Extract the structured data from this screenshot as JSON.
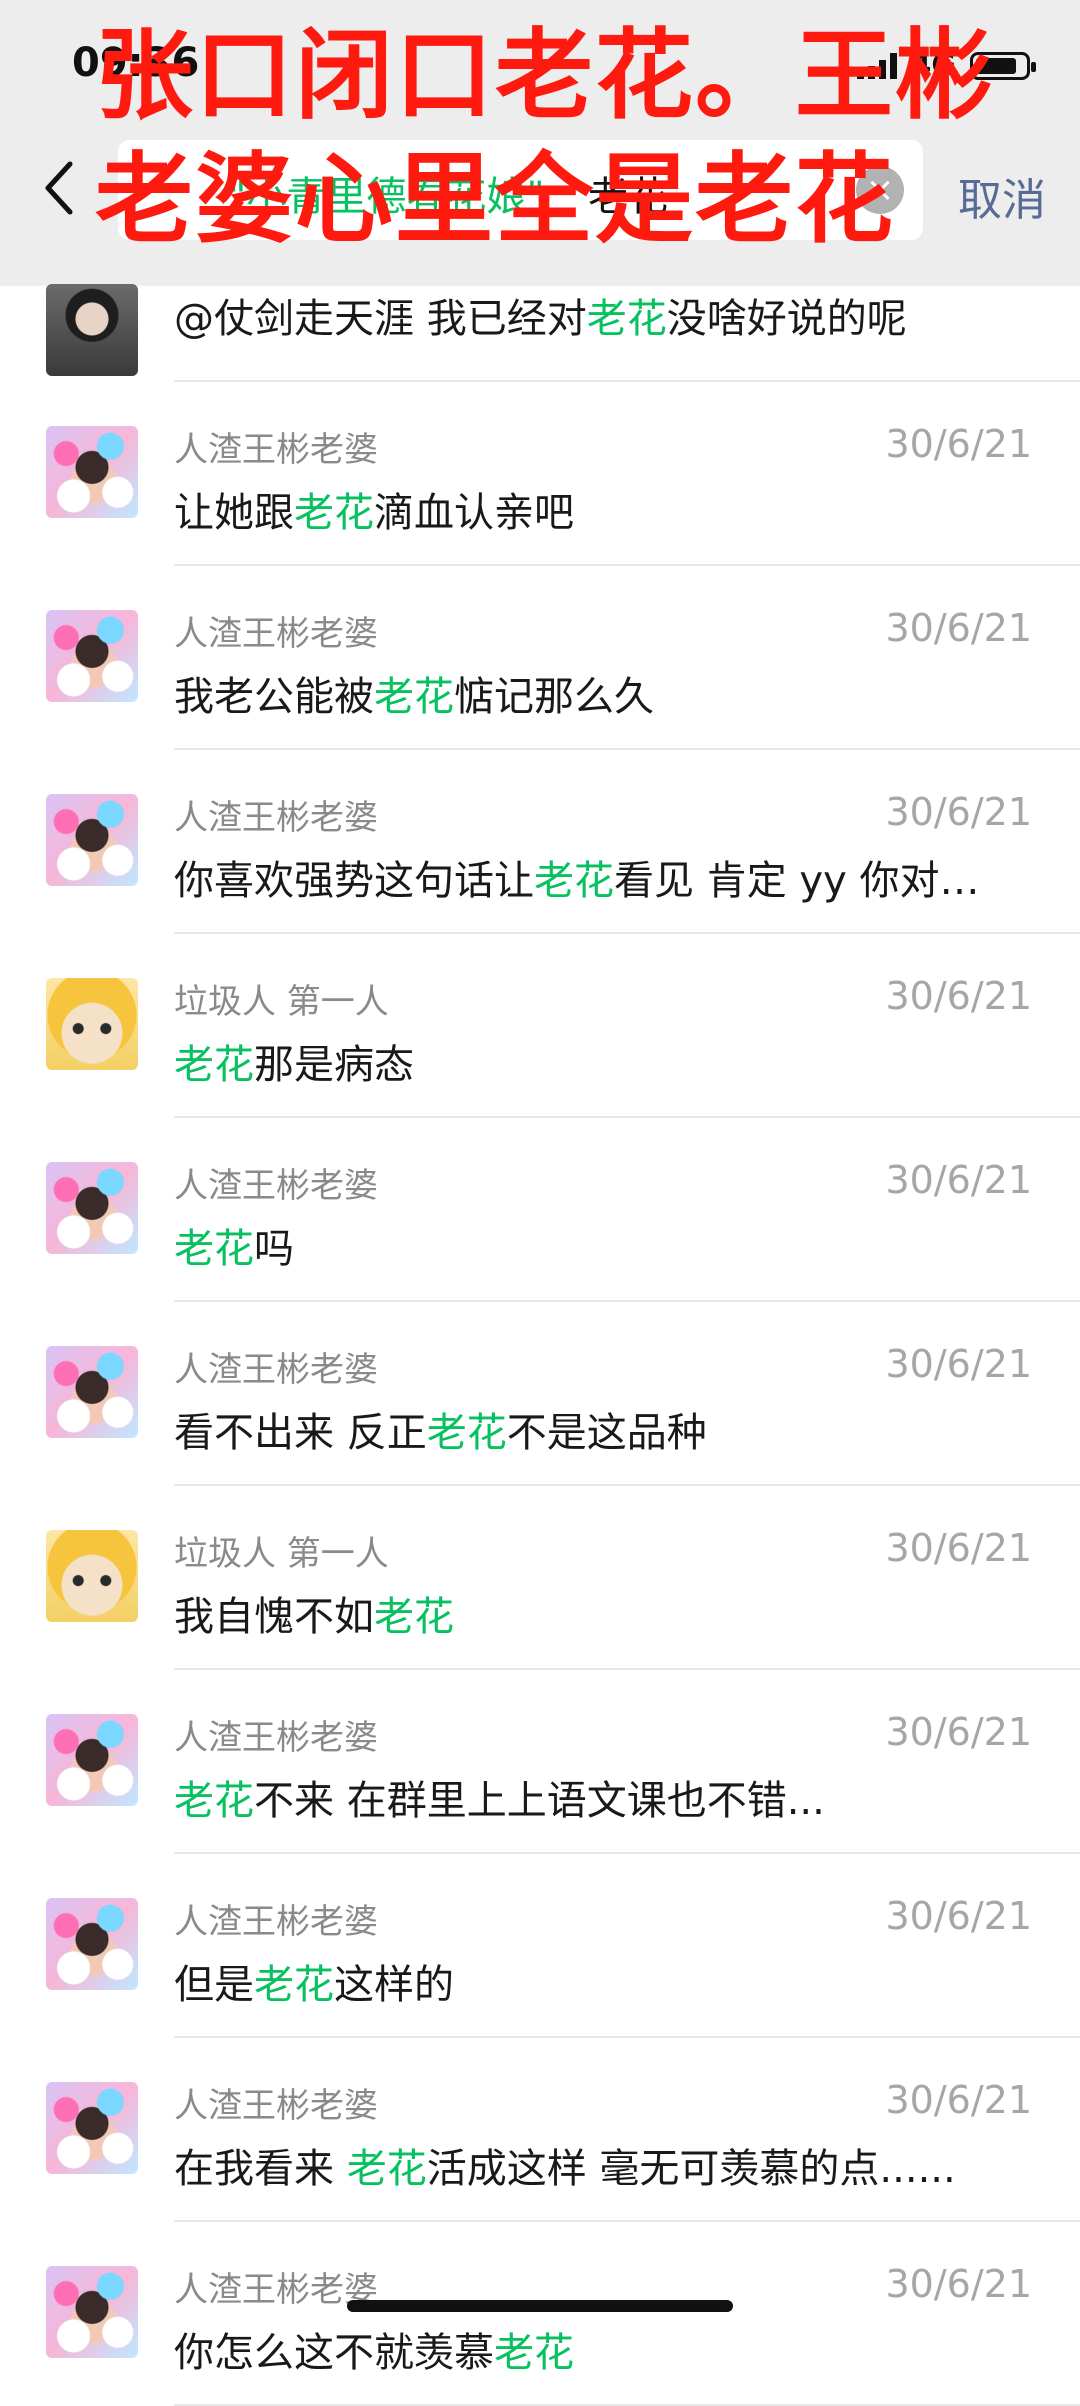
{
  "status_bar": {
    "time": "09:36",
    "network": "4G"
  },
  "search": {
    "chip": "\"小青里德春花娘\"",
    "query": "老花",
    "cancel_label": "取消"
  },
  "overlay": {
    "caption": "张口闭口老花。王彬老婆心里全是老花"
  },
  "results": [
    {
      "avatar": "photo",
      "sender": "",
      "date": "",
      "pre": "@仗剑走天涯 我已经对",
      "hl": "老花",
      "post": "没啥好说的呢",
      "partial": true
    },
    {
      "avatar": "balls",
      "sender": "人渣王彬老婆",
      "date": "30/6/21",
      "pre": "让她跟",
      "hl": "老花",
      "post": "滴血认亲吧"
    },
    {
      "avatar": "balls",
      "sender": "人渣王彬老婆",
      "date": "30/6/21",
      "pre": "我老公能被",
      "hl": "老花",
      "post": "惦记那么久"
    },
    {
      "avatar": "balls",
      "sender": "人渣王彬老婆",
      "date": "30/6/21",
      "pre": "你喜欢强势这句话让",
      "hl": "老花",
      "post": "看见 肯定 yy 你对…"
    },
    {
      "avatar": "cat",
      "sender": "垃圾人 第一人",
      "date": "30/6/21",
      "pre": "",
      "hl": "老花",
      "post": "那是病态"
    },
    {
      "avatar": "balls",
      "sender": "人渣王彬老婆",
      "date": "30/6/21",
      "pre": "",
      "hl": "老花",
      "post": "吗"
    },
    {
      "avatar": "balls",
      "sender": "人渣王彬老婆",
      "date": "30/6/21",
      "pre": "看不出来 反正",
      "hl": "老花",
      "post": "不是这品种"
    },
    {
      "avatar": "cat",
      "sender": "垃圾人 第一人",
      "date": "30/6/21",
      "pre": "我自愧不如",
      "hl": "老花",
      "post": ""
    },
    {
      "avatar": "balls",
      "sender": "人渣王彬老婆",
      "date": "30/6/21",
      "pre": "",
      "hl": "老花",
      "post": "不来 在群里上上语文课也不错..."
    },
    {
      "avatar": "balls",
      "sender": "人渣王彬老婆",
      "date": "30/6/21",
      "pre": "但是",
      "hl": "老花",
      "post": "这样的"
    },
    {
      "avatar": "balls",
      "sender": "人渣王彬老婆",
      "date": "30/6/21",
      "pre": "在我看来 ",
      "hl": "老花",
      "post": "活成这样 毫无可羡慕的点......"
    },
    {
      "avatar": "balls",
      "sender": "人渣王彬老婆",
      "date": "30/6/21",
      "pre": "你怎么这不就羡慕",
      "hl": "老花",
      "post": ""
    }
  ],
  "colors": {
    "highlight": "#07c160",
    "cancel": "#576b95",
    "overlay": "#ff1a10"
  }
}
